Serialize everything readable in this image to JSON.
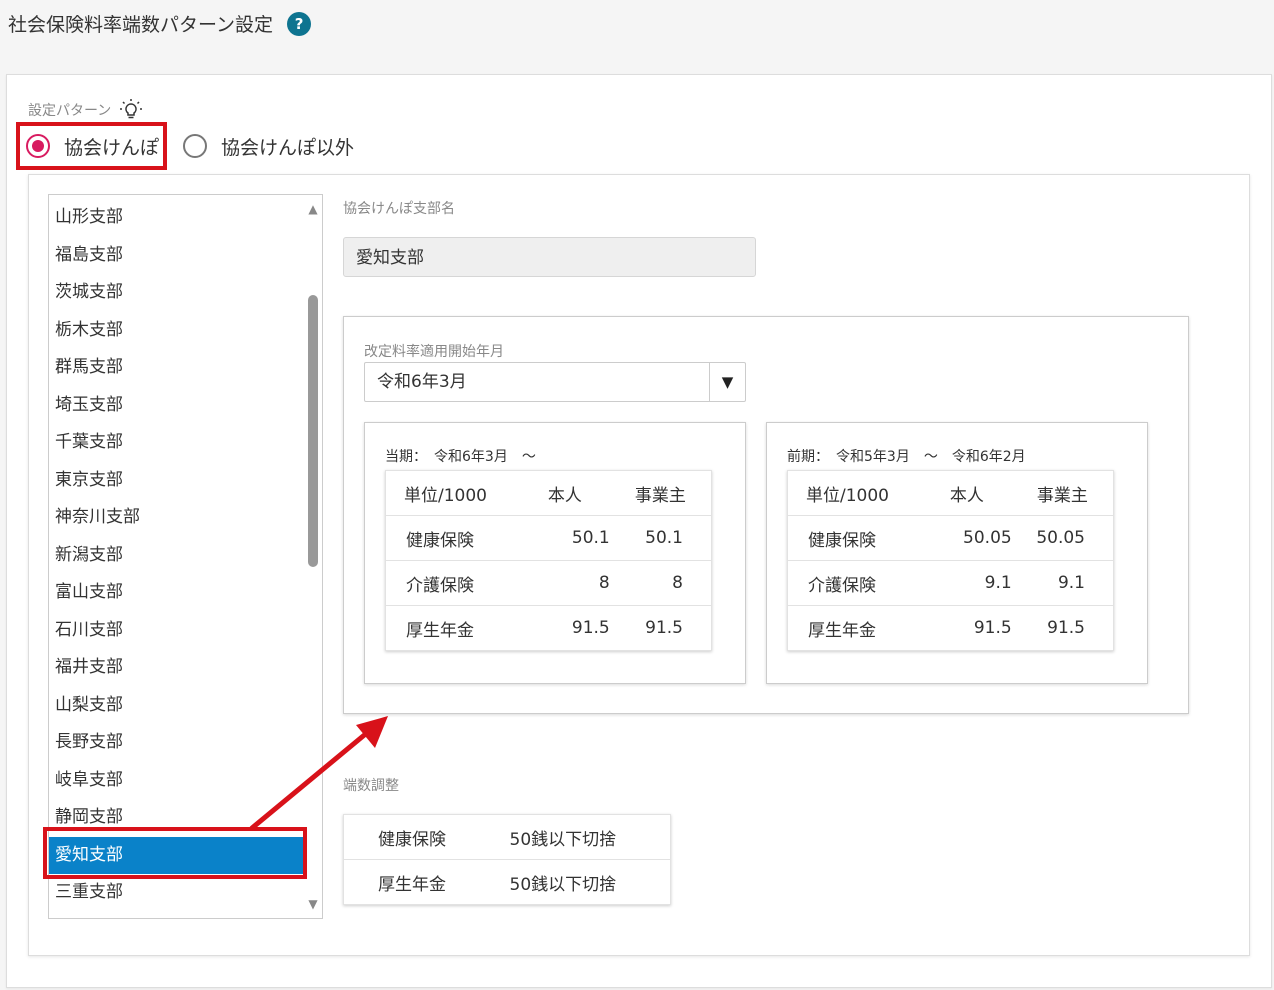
{
  "page": {
    "title": "社会保険料率端数パターン設定",
    "help_icon": "question-circle-icon"
  },
  "pattern": {
    "label": "設定パターン",
    "options": [
      {
        "label": "協会けんぽ",
        "checked": true
      },
      {
        "label": "協会けんぽ以外",
        "checked": false
      }
    ]
  },
  "branches": {
    "items": [
      "山形支部",
      "福島支部",
      "茨城支部",
      "栃木支部",
      "群馬支部",
      "埼玉支部",
      "千葉支部",
      "東京支部",
      "神奈川支部",
      "新潟支部",
      "富山支部",
      "石川支部",
      "福井支部",
      "山梨支部",
      "長野支部",
      "岐阜支部",
      "静岡支部",
      "愛知支部",
      "三重支部"
    ],
    "selected": "愛知支部"
  },
  "branch_name": {
    "label": "協会けんぽ支部名",
    "value": "愛知支部"
  },
  "revision": {
    "label": "改定料率適用開始年月",
    "value": "令和6年3月"
  },
  "current": {
    "label": "当期：　令和6年3月　～",
    "headers": [
      "単位/1000",
      "本人",
      "事業主"
    ],
    "rows": [
      [
        "健康保険",
        "50.1",
        "50.1"
      ],
      [
        "介護保険",
        "8",
        "8"
      ],
      [
        "厚生年金",
        "91.5",
        "91.5"
      ]
    ]
  },
  "previous": {
    "label": "前期：　令和5年3月　～　令和6年2月",
    "headers": [
      "単位/1000",
      "本人",
      "事業主"
    ],
    "rows": [
      [
        "健康保険",
        "50.05",
        "50.05"
      ],
      [
        "介護保険",
        "9.1",
        "9.1"
      ],
      [
        "厚生年金",
        "91.5",
        "91.5"
      ]
    ]
  },
  "rounding": {
    "label": "端数調整",
    "rows": [
      [
        "健康保険",
        "50銭以下切捨"
      ],
      [
        "厚生年金",
        "50銭以下切捨"
      ]
    ]
  },
  "colors": {
    "highlight": "#d8121a",
    "selected_bg": "#0a82c9",
    "radio_accent": "#d81b60",
    "help": "#0e7490"
  }
}
